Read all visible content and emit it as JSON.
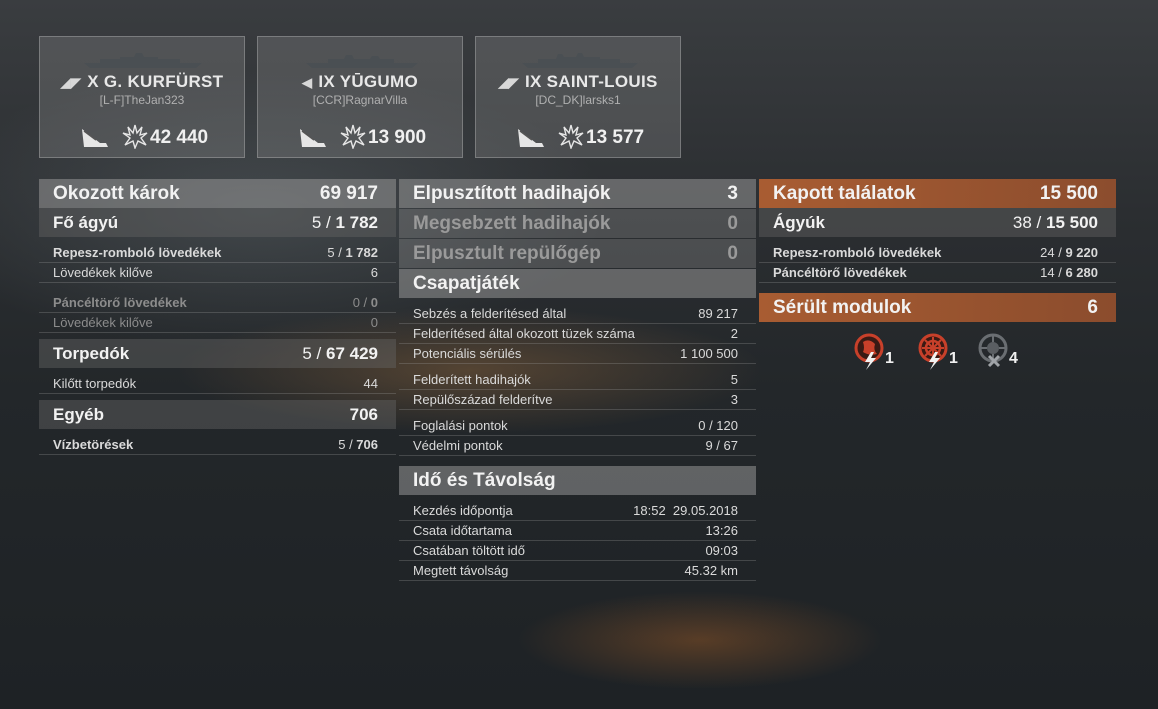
{
  "ships": [
    {
      "name": "X G. KURFÜRST",
      "player": "[L-F]TheJan323",
      "damage": "42 440"
    },
    {
      "name": "IX YŪGUMO",
      "player": "[CCR]RagnarVilla",
      "damage": "13 900"
    },
    {
      "name": "IX SAINT-LOUIS",
      "player": "[DC_DK]larsks1",
      "damage": "13 577"
    }
  ],
  "damage": {
    "title": "Okozott károk",
    "total": "69 917",
    "main": {
      "title": "Fő ágyú",
      "hits": "5",
      "value": "1 782"
    },
    "he": {
      "label": "Repesz-romboló lövedékek",
      "hits": "5",
      "value": "1 782"
    },
    "he_fired": {
      "label": "Lövedékek kilőve",
      "value": "6"
    },
    "ap": {
      "label": "Páncéltörő lövedékek",
      "hits": "0",
      "value": "0"
    },
    "ap_fired": {
      "label": "Lövedékek kilőve",
      "value": "0"
    },
    "torp": {
      "title": "Torpedók",
      "hits": "5",
      "value": "67 429"
    },
    "torp_fired": {
      "label": "Kilőtt torpedók",
      "value": "44"
    },
    "other": {
      "title": "Egyéb",
      "value": "706"
    },
    "flood": {
      "label": "Vízbetörések",
      "hits": "5",
      "value": "706"
    }
  },
  "middle": {
    "destroyed": {
      "label": "Elpusztított hadihajók",
      "value": "3"
    },
    "damaged": {
      "label": "Megsebzett hadihajók",
      "value": "0"
    },
    "planes": {
      "label": "Elpusztult repülőgép",
      "value": "0"
    },
    "team": {
      "title": "Csapatjáték",
      "rows": [
        {
          "label": "Sebzés a felderítésed által",
          "value": "89 217"
        },
        {
          "label": "Felderítésed által okozott tüzek száma",
          "value": "2"
        },
        {
          "label": "Potenciális sérülés",
          "value": "1 100 500"
        },
        {
          "label": "Felderített hadihajók",
          "value": "5"
        },
        {
          "label": "Repülőszázad felderítve",
          "value": "3"
        },
        {
          "label": "Foglalási pontok",
          "value": "0 / 120"
        },
        {
          "label": "Védelmi pontok",
          "value": "9 / 67"
        }
      ]
    },
    "time": {
      "title": "Idő és Távolság",
      "rows": [
        {
          "label": "Kezdés időpontja",
          "value": "18:52  29.05.2018"
        },
        {
          "label": "Csata időtartama",
          "value": "13:26"
        },
        {
          "label": "Csatában töltött idő",
          "value": "09:03"
        },
        {
          "label": "Megtett távolság",
          "value": "45.32 km"
        }
      ]
    }
  },
  "received": {
    "title": "Kapott találatok",
    "total": "15 500",
    "guns": {
      "title": "Ágyúk",
      "hits": "38",
      "value": "15 500"
    },
    "he": {
      "label": "Repesz-romboló lövedékek",
      "hits": "24",
      "value": "9 220"
    },
    "ap": {
      "label": "Páncéltörő lövedékek",
      "hits": "14",
      "value": "6 280"
    },
    "modules": {
      "title": "Sérült modulok",
      "value": "6"
    },
    "module_icons": [
      {
        "icon": "damaged-engine-icon",
        "count": "1"
      },
      {
        "icon": "damaged-steering-icon",
        "count": "1"
      },
      {
        "icon": "destroyed-turret-icon",
        "count": "4"
      }
    ]
  },
  "colors": {
    "accent_orange": "#b0602f",
    "panel": "#8a8a8a"
  }
}
